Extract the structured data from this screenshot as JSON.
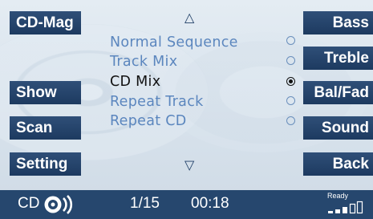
{
  "left_buttons": [
    "CD-Mag",
    "Show",
    "Scan",
    "Setting"
  ],
  "right_buttons": [
    "Bass",
    "Treble",
    "Bal/Fad",
    "Sound",
    "Back"
  ],
  "menu": {
    "items": [
      {
        "label": "Normal Sequence",
        "selected": false
      },
      {
        "label": "Track Mix",
        "selected": false
      },
      {
        "label": "CD Mix",
        "selected": true
      },
      {
        "label": "Repeat Track",
        "selected": false
      },
      {
        "label": "Repeat CD",
        "selected": false
      }
    ],
    "up_arrow": "△",
    "down_arrow": "▽"
  },
  "status_bar": {
    "source_label": "CD",
    "track": "1/15",
    "time": "00:18",
    "ready_label": "Ready"
  },
  "colors": {
    "active_text": "#111111",
    "inactive_text": "#5b86be",
    "button_bg": "#1d3a60"
  }
}
